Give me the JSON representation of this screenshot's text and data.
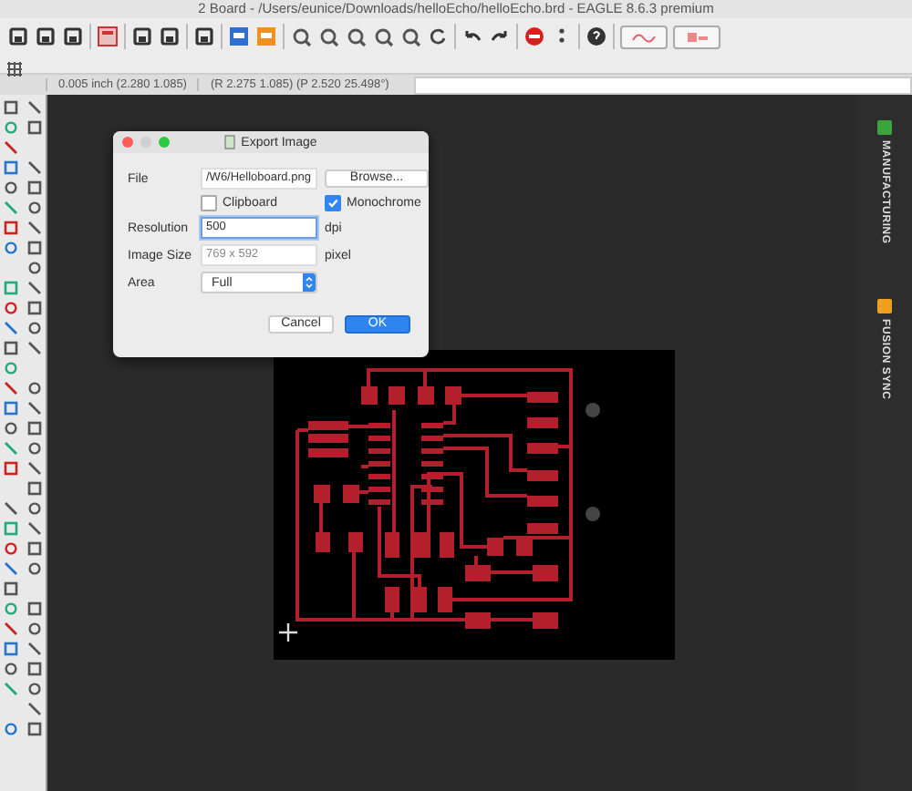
{
  "window": {
    "title": "2 Board - /Users/eunice/Downloads/helloEcho/helloEcho.brd - EAGLE 8.6.3 premium"
  },
  "status": {
    "grid": "0.005 inch (2.280 1.085)",
    "position": "(R 2.275 1.085) (P 2.520 25.498°)"
  },
  "dialog": {
    "title": "Export Image",
    "file_label": "File",
    "file_value": "/W6/Helloboard.png",
    "browse": "Browse...",
    "options": [
      {
        "label": "Clipboard",
        "checked": false
      },
      {
        "label": "Monochrome",
        "checked": true
      }
    ],
    "resolution_label": "Resolution",
    "resolution_value": "500",
    "resolution_unit": "dpi",
    "size_label": "Image Size",
    "size_value": "769 x 592",
    "size_unit": "pixel",
    "area_label": "Area",
    "area_value": "Full",
    "buttons": [
      {
        "label": "Cancel",
        "kind": "cancel"
      },
      {
        "label": "OK",
        "kind": "default"
      }
    ]
  },
  "side_panel": [
    {
      "label": "MANUFACTURING",
      "color": "#3aa53a"
    },
    {
      "label": "FUSION SYNC",
      "color": "#f0a020"
    }
  ]
}
